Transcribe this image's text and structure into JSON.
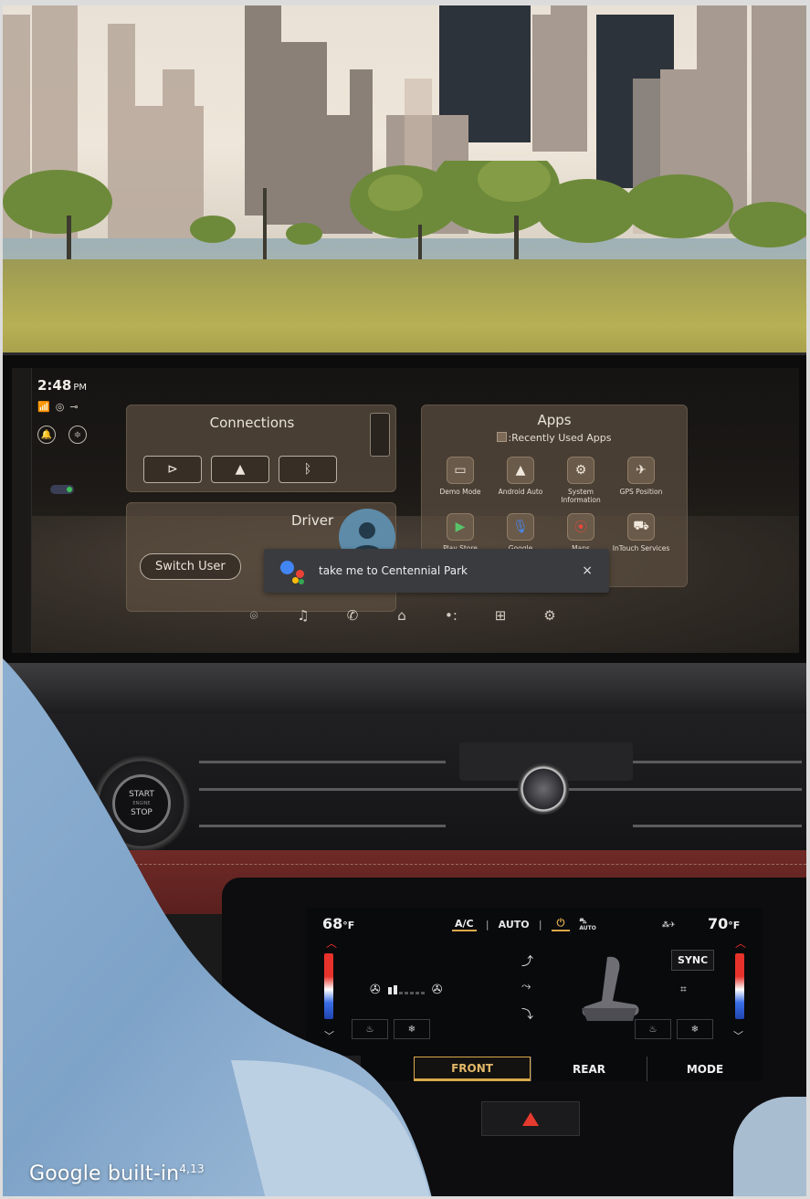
{
  "infotainment": {
    "clock": {
      "time": "2:48",
      "period": "PM"
    },
    "status_icons": [
      "wifi-icon",
      "hotspot-icon",
      "vehicle-icon"
    ],
    "connections": {
      "title": "Connections",
      "buttons": [
        "media-play-icon",
        "android-auto-icon",
        "bluetooth-icon"
      ]
    },
    "driver": {
      "title": "Driver",
      "switch_user_label": "Switch User"
    },
    "apps": {
      "title": "Apps",
      "recently_used_label": ":Recently Used Apps",
      "items": [
        {
          "label": "Demo Mode",
          "icon": "demo-mode-icon"
        },
        {
          "label": "Android Auto",
          "icon": "android-auto-icon"
        },
        {
          "label": "System Information",
          "icon": "system-info-icon"
        },
        {
          "label": "GPS Position",
          "icon": "gps-icon"
        },
        {
          "label": "Play Store",
          "icon": "play-store-icon"
        },
        {
          "label": "Google",
          "icon": "google-mic-icon"
        },
        {
          "label": "Maps",
          "icon": "maps-icon"
        },
        {
          "label": "InTouch Services",
          "icon": "intouch-icon"
        }
      ]
    },
    "assistant": {
      "query": "take me to Centennial Park",
      "close_label": "×"
    },
    "dock": [
      "nav-icon",
      "music-icon",
      "phone-icon",
      "home-icon",
      "assistant-icon",
      "apps-grid-icon",
      "settings-icon"
    ]
  },
  "dash": {
    "start_button": {
      "line1": "START",
      "line2": "ENGINE",
      "line3": "STOP"
    }
  },
  "climate": {
    "driver_temp": "68",
    "passenger_temp": "70",
    "unit": "°F",
    "ac_label": "A/C",
    "auto_label": "AUTO",
    "auto_badge": "AUTO",
    "sync_label": "SYNC",
    "fan_level": 2,
    "fan_max": 7,
    "tabs": [
      {
        "label": "FRONT",
        "active": true
      },
      {
        "label": "REAR",
        "active": false
      },
      {
        "label": "MODE",
        "active": false
      }
    ],
    "colors": {
      "accent": "#d9a94a",
      "hot": "#e6322a",
      "cold": "#3a6ee8"
    }
  },
  "caption": {
    "text": "Google built-in",
    "superscript": "4,13"
  }
}
